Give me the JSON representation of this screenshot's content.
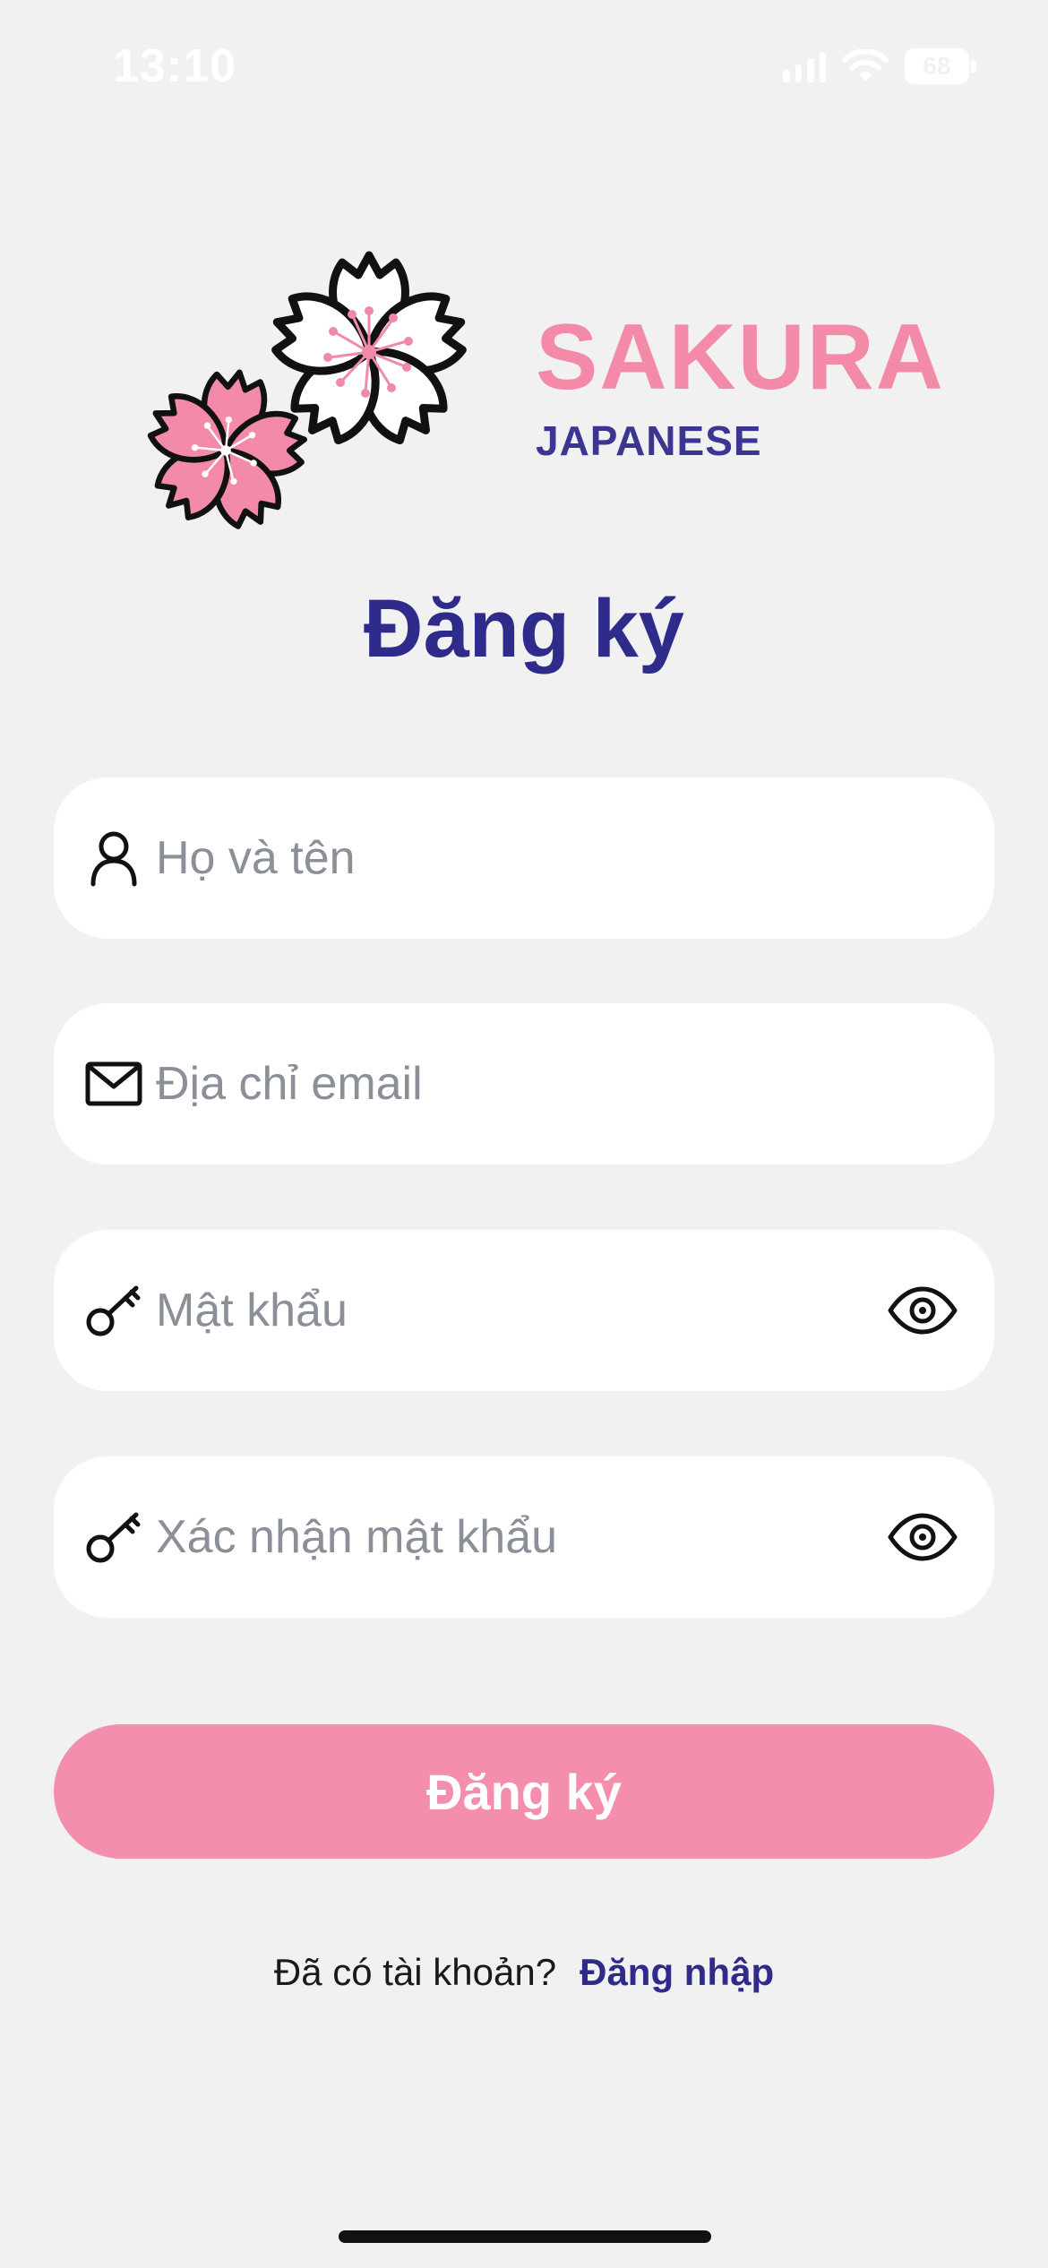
{
  "status_bar": {
    "time": "13:10",
    "battery": "68"
  },
  "logo": {
    "brand": "SAKURA",
    "subtitle": "JAPANESE"
  },
  "page": {
    "title": "Đăng ký"
  },
  "form": {
    "full_name": {
      "placeholder": "Họ và tên",
      "icon": "user-icon"
    },
    "email": {
      "placeholder": "Địa chỉ email",
      "icon": "mail-icon"
    },
    "password": {
      "placeholder": "Mật khẩu",
      "icon": "key-icon",
      "toggle_icon": "eye-icon"
    },
    "confirm_password": {
      "placeholder": "Xác nhận mật khẩu",
      "icon": "key-icon",
      "toggle_icon": "eye-icon"
    },
    "submit_label": "Đăng ký"
  },
  "footer": {
    "question": "Đã có tài khoản?",
    "login_link": "Đăng nhập"
  },
  "colors": {
    "primary": "#2e2b8a",
    "accent": "#f38fad",
    "background": "#f1f1f1"
  }
}
